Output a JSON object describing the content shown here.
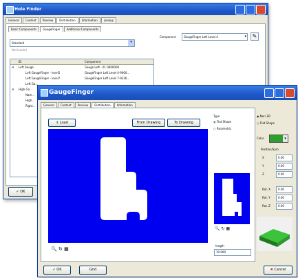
{
  "back_window": {
    "title": "Hole Finder",
    "tabs": [
      "General",
      "Content",
      "Preview",
      "Distribution",
      "Information",
      "Lookup"
    ],
    "subtabs": [
      "Basic Components",
      "GaugeFinger",
      "Additional Components"
    ],
    "standard_value": "Standard",
    "status": "Not loaded",
    "grid_headers": [
      "ID",
      "Component"
    ],
    "grid_rows": [
      {
        "id": "Left Gauge",
        "comp": "Gauge Left - 01 0000000"
      },
      {
        "id": "Left GaugeFinger - level5",
        "comp": "GaugeFinger Left Level 4-9000..."
      },
      {
        "id": "Left GaugeFinger - level7",
        "comp": "GaugeFinger Left Level 7-9236..."
      },
      {
        "id": "Left Ga...",
        "comp": ""
      },
      {
        "id": "High Ga...",
        "comp": ""
      },
      {
        "id": "Nam...",
        "comp": ""
      },
      {
        "id": "High...",
        "comp": ""
      },
      {
        "id": "Right...",
        "comp": ""
      }
    ],
    "component_label": "Component",
    "component_value": "GaugeFinger Left Level 4",
    "ok_label": "OK"
  },
  "front_window": {
    "title": "GaugeFinger",
    "tabs": [
      "General",
      "Content",
      "Preview",
      "Distribution",
      "Information"
    ],
    "load_label": "Load",
    "from_drawing_label": "From Drawing",
    "to_drawing_label": "To Drawing",
    "type_label": "Type",
    "type_options": [
      "Flat Shape",
      "Parametric"
    ],
    "view_options": [
      "Non 3D",
      "Flat Shape"
    ],
    "color_label": "Color",
    "position_label": "Position/Sym",
    "coords": [
      {
        "label": "X",
        "value": "0.00"
      },
      {
        "label": "Y",
        "value": "0.00"
      },
      {
        "label": "Z",
        "value": "0.00"
      },
      {
        "label": "Rot. X",
        "value": "0.00"
      },
      {
        "label": "Rot. Y",
        "value": "0.00"
      },
      {
        "label": "Rot. Z",
        "value": "0.00"
      }
    ],
    "length_label": "length",
    "length_value": "10.000",
    "ok_label": "OK",
    "grid_label": "Grid",
    "cancel_label": "Cancel",
    "colors": {
      "canvas": "#0000f0",
      "shape": "#ffffff",
      "accent": "#2aa12a"
    }
  }
}
